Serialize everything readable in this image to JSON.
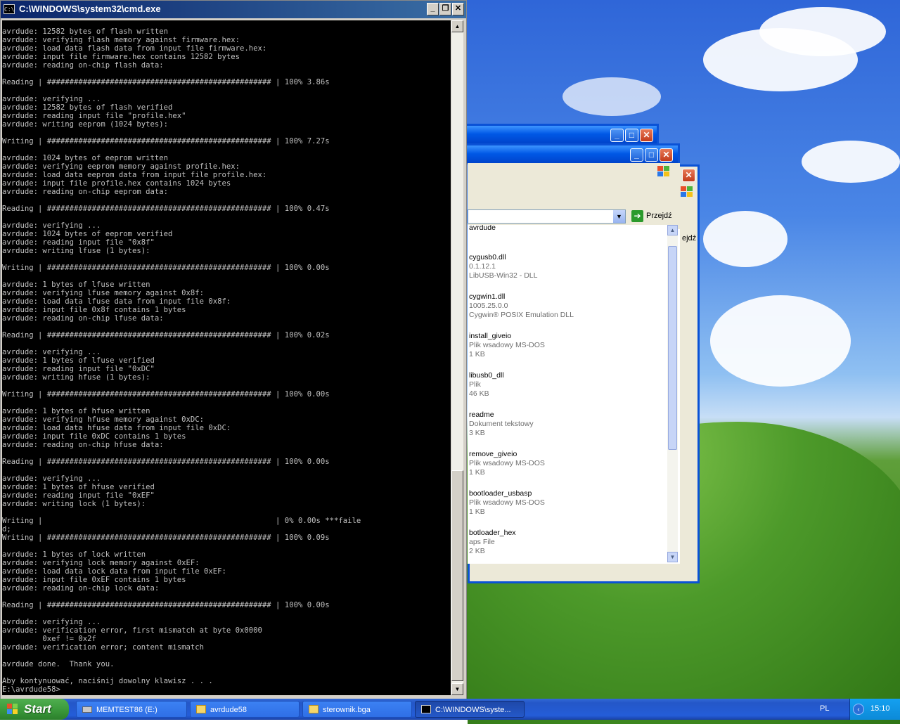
{
  "cmd": {
    "title": "C:\\WINDOWS\\system32\\cmd.exe",
    "icon": "C:\\",
    "output": "avrdude: 12582 bytes of flash written\navrdude: verifying flash memory against firmware.hex:\navrdude: load data flash data from input file firmware.hex:\navrdude: input file firmware.hex contains 12582 bytes\navrdude: reading on-chip flash data:\n\nReading | ################################################## | 100% 3.86s\n\navrdude: verifying ...\navrdude: 12582 bytes of flash verified\navrdude: reading input file \"profile.hex\"\navrdude: writing eeprom (1024 bytes):\n\nWriting | ################################################## | 100% 7.27s\n\navrdude: 1024 bytes of eeprom written\navrdude: verifying eeprom memory against profile.hex:\navrdude: load data eeprom data from input file profile.hex:\navrdude: input file profile.hex contains 1024 bytes\navrdude: reading on-chip eeprom data:\n\nReading | ################################################## | 100% 0.47s\n\navrdude: verifying ...\navrdude: 1024 bytes of eeprom verified\navrdude: reading input file \"0x8f\"\navrdude: writing lfuse (1 bytes):\n\nWriting | ################################################## | 100% 0.00s\n\navrdude: 1 bytes of lfuse written\navrdude: verifying lfuse memory against 0x8f:\navrdude: load data lfuse data from input file 0x8f:\navrdude: input file 0x8f contains 1 bytes\navrdude: reading on-chip lfuse data:\n\nReading | ################################################## | 100% 0.02s\n\navrdude: verifying ...\navrdude: 1 bytes of lfuse verified\navrdude: reading input file \"0xDC\"\navrdude: writing hfuse (1 bytes):\n\nWriting | ################################################## | 100% 0.00s\n\navrdude: 1 bytes of hfuse written\navrdude: verifying hfuse memory against 0xDC:\navrdude: load data hfuse data from input file 0xDC:\navrdude: input file 0xDC contains 1 bytes\navrdude: reading on-chip hfuse data:\n\nReading | ################################################## | 100% 0.00s\n\navrdude: verifying ...\navrdude: 1 bytes of hfuse verified\navrdude: reading input file \"0xEF\"\navrdude: writing lock (1 bytes):\n\nWriting |                                                    | 0% 0.00s ***faile\nd;\nWriting | ################################################## | 100% 0.09s\n\navrdude: 1 bytes of lock written\navrdude: verifying lock memory against 0xEF:\navrdude: load data lock data from input file 0xEF:\navrdude: input file 0xEF contains 1 bytes\navrdude: reading on-chip lock data:\n\nReading | ################################################## | 100% 0.00s\n\navrdude: verifying ...\navrdude: verification error, first mismatch at byte 0x0000\n         0xef != 0x2f\navrdude: verification error; content mismatch\n\navrdude done.  Thank you.\n\nAby kontynuować, naciśnij dowolny klawisz . . .\nE:\\avrdude58>"
  },
  "explorer": {
    "go_label": "Przejdź",
    "go_label_partial": "ejdź",
    "files": [
      {
        "name": "avrdude",
        "line1": "",
        "line2": ""
      },
      {
        "name": "cygusb0.dll",
        "line1": "0.1.12.1",
        "line2": "LibUSB-Win32 - DLL"
      },
      {
        "name": "cygwin1.dll",
        "line1": "1005.25.0.0",
        "line2": "Cygwin® POSIX Emulation DLL"
      },
      {
        "name": "install_giveio",
        "line1": "Plik wsadowy MS-DOS",
        "line2": "1 KB"
      },
      {
        "name": "libusb0_dll",
        "line1": "Plik",
        "line2": "46 KB"
      },
      {
        "name": "readme",
        "line1": "Dokument tekstowy",
        "line2": "3 KB"
      },
      {
        "name": "remove_giveio",
        "line1": "Plik wsadowy MS-DOS",
        "line2": "1 KB"
      },
      {
        "name": "bootloader_usbasp",
        "line1": "Plik wsadowy MS-DOS",
        "line2": "1 KB"
      },
      {
        "name": "botloader_hex",
        "line1": "aps File",
        "line2": "2 KB"
      }
    ]
  },
  "taskbar": {
    "start_label": "Start",
    "tasks": [
      {
        "label": "MEMTEST86 (E:)",
        "icon": "drive-icon"
      },
      {
        "label": "avrdude58",
        "icon": "folder-icon"
      },
      {
        "label": "sterownik.bga",
        "icon": "folder-icon"
      },
      {
        "label": "C:\\WINDOWS\\syste...",
        "icon": "cmd-icon"
      }
    ],
    "language": "PL",
    "clock": "15:10"
  }
}
